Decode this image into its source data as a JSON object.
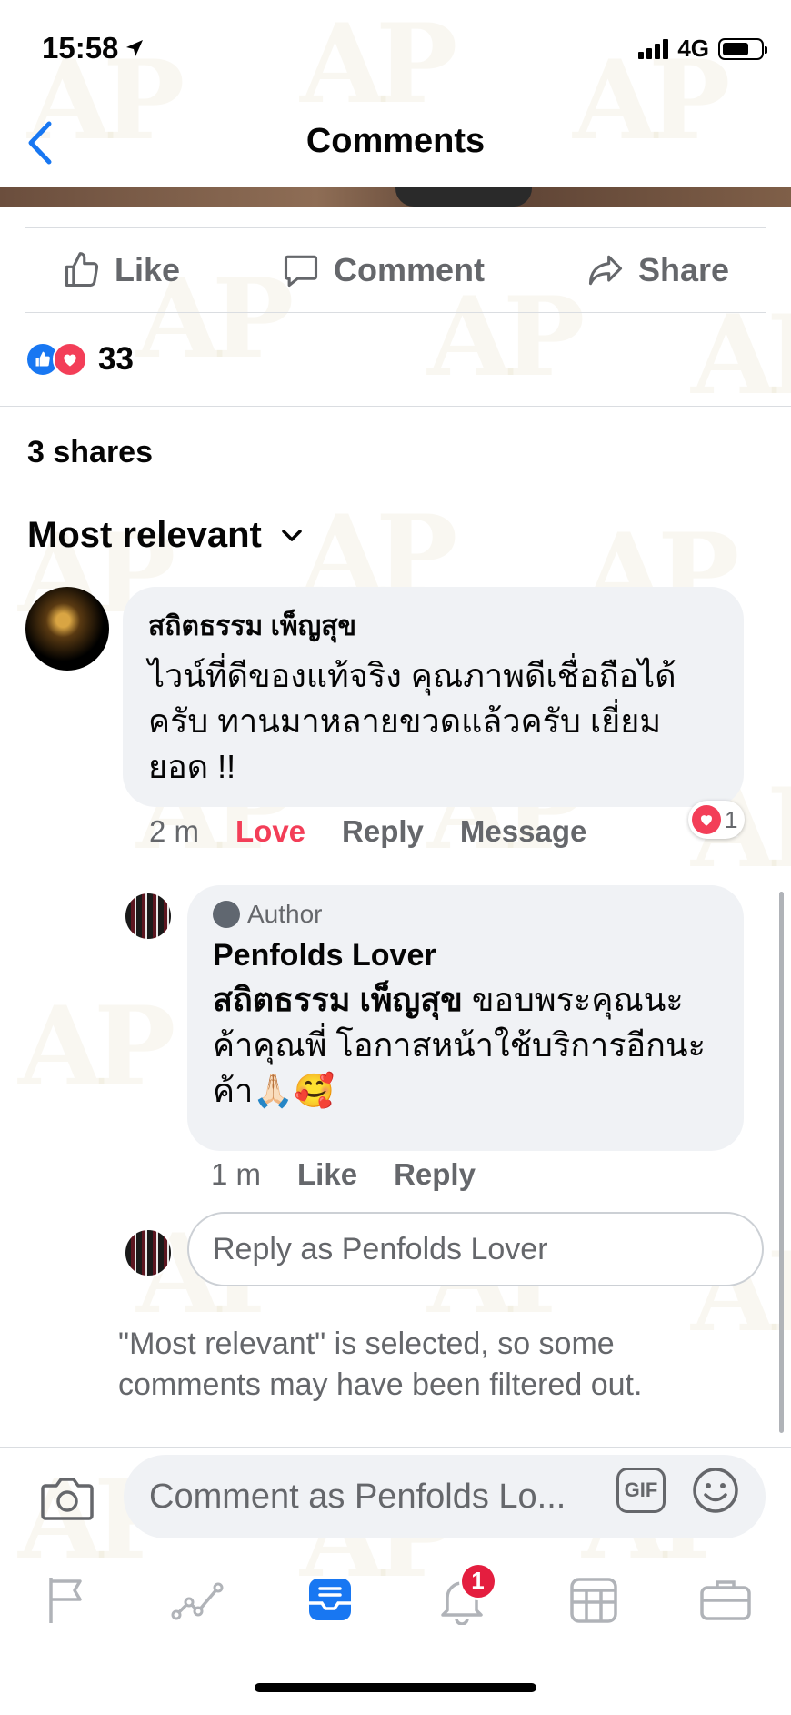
{
  "status_bar": {
    "time": "15:58",
    "network": "4G"
  },
  "header": {
    "title": "Comments"
  },
  "actions": {
    "like": "Like",
    "comment": "Comment",
    "share": "Share"
  },
  "reactions": {
    "count": "33"
  },
  "shares": "3 shares",
  "sort": {
    "label": "Most relevant"
  },
  "comment": {
    "author": "สถิตธรรม เพ็ญสุข",
    "text": "ไวน์ที่ดีของแท้จริง คุณภาพดีเชื่อถือได้ครับ ทานมาหลายขวดแล้วครับ เยี่ยมยอด !!",
    "time": "2 m",
    "love": "Love",
    "reply": "Reply",
    "message": "Message",
    "love_count": "1"
  },
  "reply": {
    "author_badge": "Author",
    "author": "Penfolds Lover",
    "mention": "สถิตธรรม เพ็ญสุข",
    "text": " ขอบพระคุณนะค้าคุณพี่ โอกาสหน้าใช้บริการอีกนะค้า🙏🏻🥰",
    "time": "1 m",
    "like": "Like",
    "reply": "Reply"
  },
  "reply_input": {
    "placeholder": "Reply as Penfolds Lover"
  },
  "filter_note": "\"Most relevant\" is selected, so some comments may have been filtered out.",
  "composer": {
    "placeholder": "Comment as Penfolds Lo...",
    "gif": "GIF"
  },
  "tabbar": {
    "notifications_badge": "1"
  },
  "colors": {
    "accent": "#1877f2",
    "love": "#f33e58",
    "muted": "#65676b",
    "badge": "#e41e3f"
  }
}
